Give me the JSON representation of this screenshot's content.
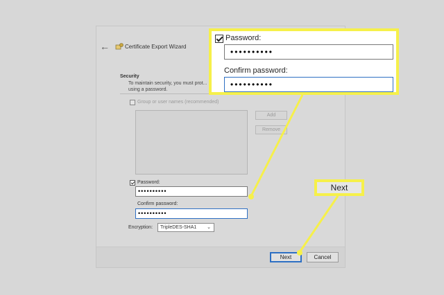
{
  "window": {
    "title": "Certificate Export Wizard",
    "back_icon": "back-arrow-icon",
    "wizard_icon": "certificate-icon"
  },
  "security": {
    "heading": "Security",
    "description": "To maintain security, you must prot... using a password.",
    "group_checkbox_label": "Group or user names (recommended)",
    "add_label": "Add",
    "remove_label": "Remove",
    "password_label": "Password:",
    "password_value": "••••••••••",
    "confirm_label": "Confirm password:",
    "confirm_value": "••••••••••",
    "encryption_label": "Encryption:",
    "encryption_value": "TripleDES-SHA1"
  },
  "footer": {
    "next_label": "Next",
    "cancel_label": "Cancel"
  },
  "callout": {
    "password_label": "Password:",
    "password_value": "••••••••••",
    "confirm_label": "Confirm password:",
    "confirm_value": "••••••••••",
    "next_label": "Next"
  },
  "colors": {
    "highlight": "#f6f04a",
    "focus": "#2d6fc3"
  }
}
